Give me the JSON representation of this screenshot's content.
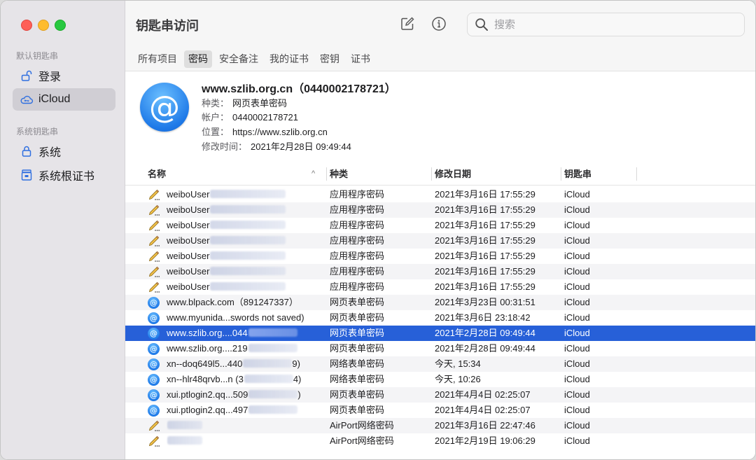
{
  "window": {
    "app_title": "钥匙串访问"
  },
  "sidebar": {
    "sections": [
      {
        "label": "默认钥匙串",
        "items": [
          {
            "label": "登录",
            "icon": "unlocked-icon"
          },
          {
            "label": "iCloud",
            "icon": "icloud-icon",
            "selected": true
          }
        ]
      },
      {
        "label": "系统钥匙串",
        "items": [
          {
            "label": "系统",
            "icon": "lock-icon"
          },
          {
            "label": "系统根证书",
            "icon": "cabinet-icon"
          }
        ]
      }
    ]
  },
  "toolbar": {
    "compose_icon": "compose-icon",
    "info_icon": "info-icon",
    "search": {
      "placeholder": "搜索",
      "value": ""
    }
  },
  "tabs": [
    {
      "label": "所有项目"
    },
    {
      "label": "密码",
      "active": true
    },
    {
      "label": "安全备注"
    },
    {
      "label": "我的证书"
    },
    {
      "label": "密钥"
    },
    {
      "label": "证书"
    }
  ],
  "detail": {
    "title": "www.szlib.org.cn（0440002178721）",
    "kind_label": "种类：",
    "kind": "网页表单密码",
    "account_label": "帐户：",
    "account": "0440002178721",
    "location_label": "位置：",
    "location": "https://www.szlib.org.cn",
    "modified_label": "修改时间：",
    "modified": "2021年2月28日 09:49:44"
  },
  "table": {
    "columns": {
      "name": "名称",
      "kind": "种类",
      "date": "修改日期",
      "keychain": "钥匙串"
    },
    "sort_indicator": "^",
    "rows": [
      {
        "icon": "pencil-icon",
        "name": "weiboUser",
        "kind": "应用程序密码",
        "date": "2021年3月16日 17:55:29",
        "keychain": "iCloud"
      },
      {
        "icon": "pencil-icon",
        "name": "weiboUser",
        "kind": "应用程序密码",
        "date": "2021年3月16日 17:55:29",
        "keychain": "iCloud"
      },
      {
        "icon": "pencil-icon",
        "name": "weiboUser",
        "kind": "应用程序密码",
        "date": "2021年3月16日 17:55:29",
        "keychain": "iCloud"
      },
      {
        "icon": "pencil-icon",
        "name": "weiboUser",
        "kind": "应用程序密码",
        "date": "2021年3月16日 17:55:29",
        "keychain": "iCloud"
      },
      {
        "icon": "pencil-icon",
        "name": "weiboUser",
        "kind": "应用程序密码",
        "date": "2021年3月16日 17:55:29",
        "keychain": "iCloud"
      },
      {
        "icon": "pencil-icon",
        "name": "weiboUser",
        "kind": "应用程序密码",
        "date": "2021年3月16日 17:55:29",
        "keychain": "iCloud"
      },
      {
        "icon": "pencil-icon",
        "name": "weiboUser",
        "kind": "应用程序密码",
        "date": "2021年3月16日 17:55:29",
        "keychain": "iCloud"
      },
      {
        "icon": "at-icon",
        "name": "www.blpack.com（891247337）",
        "kind": "网页表单密码",
        "date": "2021年3月23日 00:31:51",
        "keychain": "iCloud"
      },
      {
        "icon": "at-icon",
        "name": "www.myunida...swords not saved)",
        "kind": "网页表单密码",
        "date": "2021年3月6日 23:18:42",
        "keychain": "iCloud"
      },
      {
        "icon": "at-icon",
        "name": "www.szlib.org....044",
        "kind": "网页表单密码",
        "date": "2021年2月28日 09:49:44",
        "keychain": "iCloud",
        "selected": true
      },
      {
        "icon": "at-icon",
        "name": "www.szlib.org....219",
        "kind": "网页表单密码",
        "date": "2021年2月28日 09:49:44",
        "keychain": "iCloud"
      },
      {
        "icon": "at-icon",
        "name": "xn--doq649l5...440",
        "name_suffix": "9)",
        "kind": "网络表单密码",
        "date": "今天, 15:34",
        "keychain": "iCloud"
      },
      {
        "icon": "at-icon",
        "name": "xn--hlr48qrvb...n (3",
        "name_suffix": "4)",
        "kind": "网络表单密码",
        "date": "今天, 10:26",
        "keychain": "iCloud"
      },
      {
        "icon": "at-icon",
        "name": "xui.ptlogin2.qq...509",
        "name_suffix": ")",
        "kind": "网页表单密码",
        "date": "2021年4月4日 02:25:07",
        "keychain": "iCloud"
      },
      {
        "icon": "at-icon",
        "name": "xui.ptlogin2.qq...497",
        "kind": "网页表单密码",
        "date": "2021年4月4日 02:25:07",
        "keychain": "iCloud"
      },
      {
        "icon": "pencil-icon",
        "name": "",
        "kind": "AirPort网络密码",
        "date": "2021年3月16日 22:47:46",
        "keychain": "iCloud"
      },
      {
        "icon": "pencil-icon",
        "name": "",
        "kind": "AirPort网络密码",
        "date": "2021年2月19日 19:06:29",
        "keychain": "iCloud"
      }
    ]
  }
}
